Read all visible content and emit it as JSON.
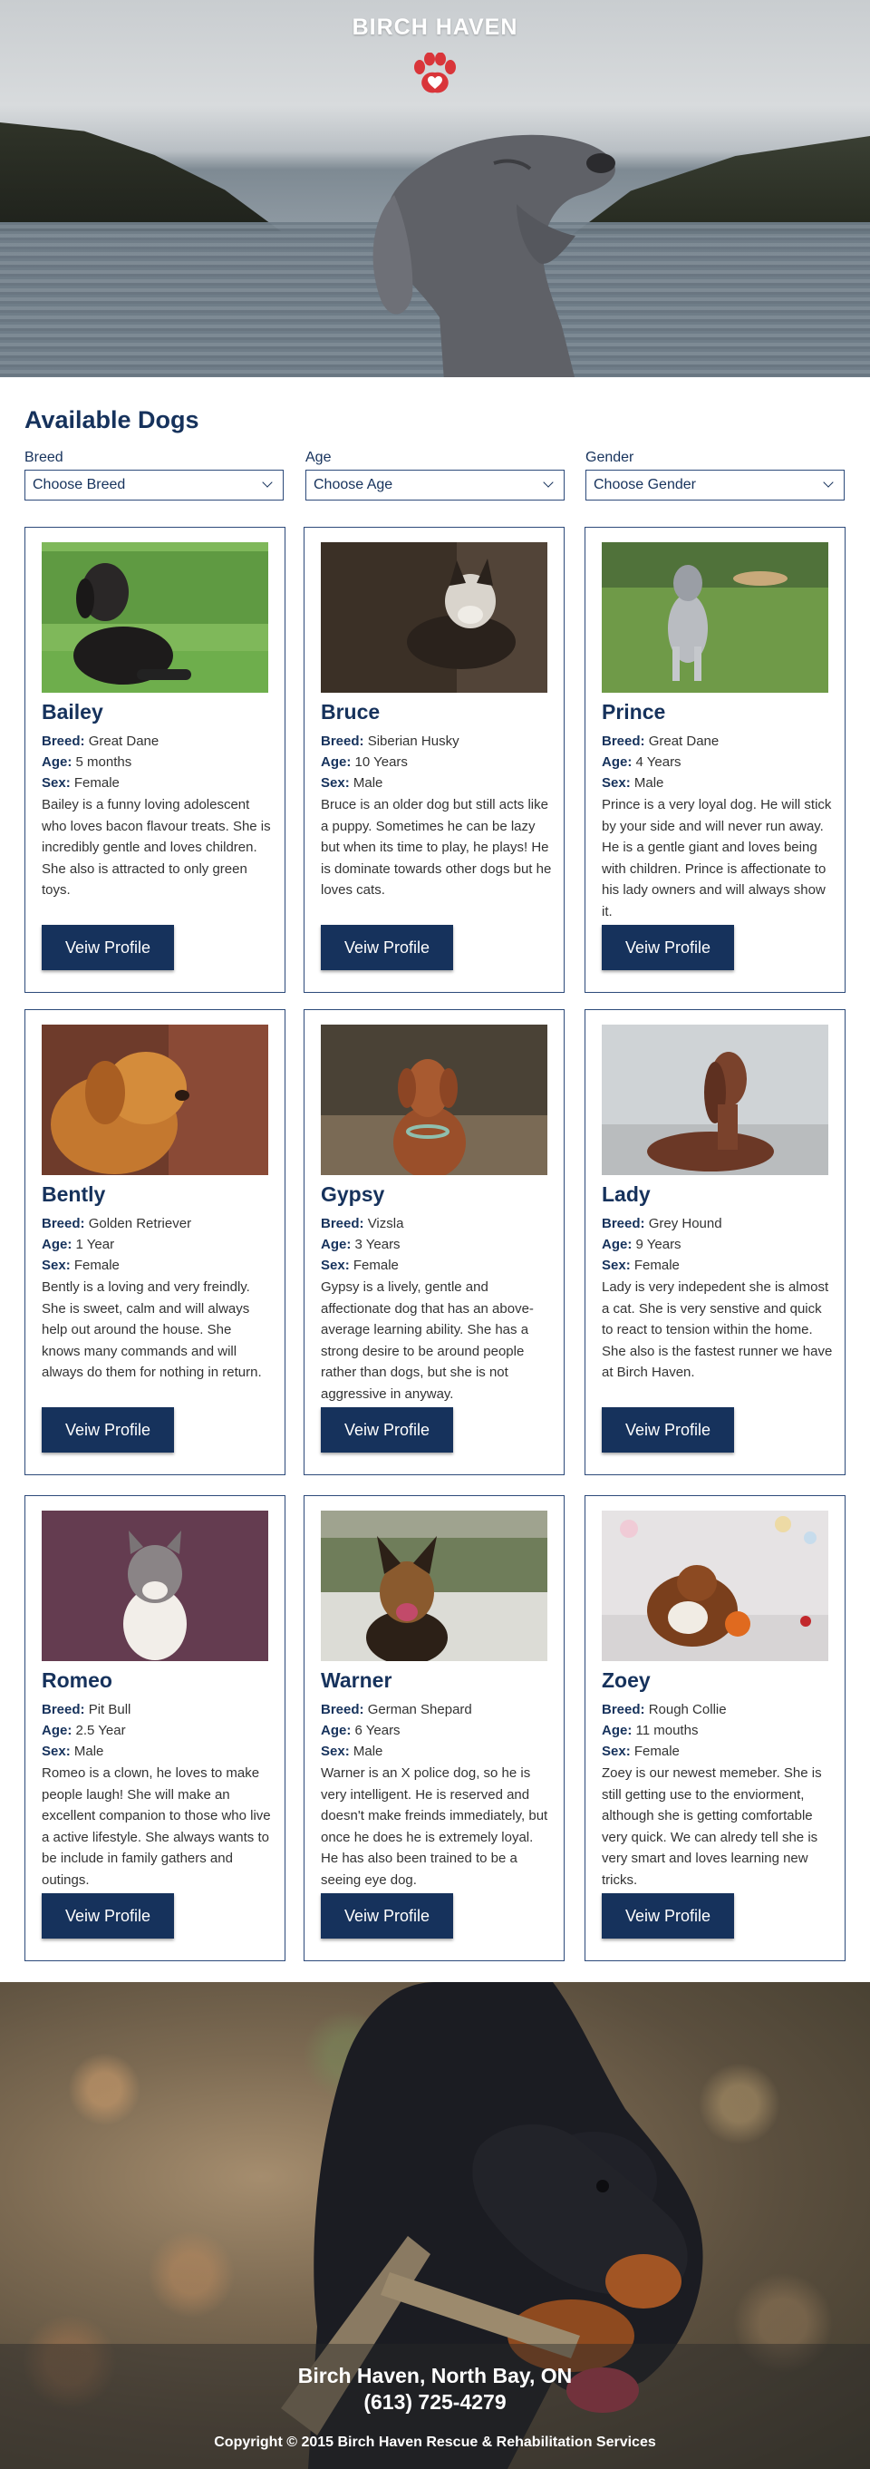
{
  "hero": {
    "title": "BIRCH HAVEN"
  },
  "section": {
    "title": "Available Dogs"
  },
  "filters": [
    {
      "label": "Breed",
      "value": "Choose Breed"
    },
    {
      "label": "Age",
      "value": "Choose Age"
    },
    {
      "label": "Gender",
      "value": "Choose Gender"
    }
  ],
  "labels": {
    "breed": "Breed:",
    "age": "Age:",
    "sex": "Sex:"
  },
  "dogs": [
    {
      "name": "Bailey",
      "breed": "Great Dane",
      "age": "5 months",
      "sex": "Female",
      "description": "Bailey is a funny loving adolescent who loves bacon flavour treats. She is incredibly gentle and loves children. She also is attracted to only green toys.",
      "button": "Veiw Profile"
    },
    {
      "name": "Bruce",
      "breed": "Siberian Husky",
      "age": "10 Years",
      "sex": "Male",
      "description": "Bruce is an older dog but still acts like a puppy. Sometimes he can be lazy but when its time to play, he plays! He is dominate towards other dogs but he loves cats.",
      "button": "Veiw Profile"
    },
    {
      "name": "Prince",
      "breed": "Great Dane",
      "age": "4 Years",
      "sex": "Male",
      "description": "Prince is a very loyal dog. He will stick by your side and will never run away. He is a gentle giant and loves being with children. Prince is affectionate to his lady owners and will always show it.",
      "button": "Veiw Profile"
    },
    {
      "name": "Bently",
      "breed": "Golden Retriever",
      "age": "1 Year",
      "sex": "Female",
      "description": "Bently is a loving and very freindly. She is sweet, calm and will always help out around the house. She knows many commands and will always do them for nothing in return.",
      "button": "Veiw Profile"
    },
    {
      "name": "Gypsy",
      "breed": "Vizsla",
      "age": "3 Years",
      "sex": "Female",
      "description": "Gypsy is a lively, gentle and affectionate dog that has an above-average learning ability. She has a strong desire to be around people rather than dogs, but she is not aggressive in anyway.",
      "button": "Veiw Profile"
    },
    {
      "name": "Lady",
      "breed": "Grey Hound",
      "age": "9 Years",
      "sex": "Female",
      "description": "Lady is very indepedent she is almost a cat. She is very senstive and quick to react to tension within the home. She also is the fastest runner we have at Birch Haven.",
      "button": "Veiw Profile"
    },
    {
      "name": "Romeo",
      "breed": "Pit Bull",
      "age": "2.5 Year",
      "sex": "Male",
      "description": "Romeo is a clown, he loves to make people laugh! She will make an excellent companion to those who live a active lifestyle. She always wants to be include in family gathers and outings.",
      "button": "Veiw Profile"
    },
    {
      "name": "Warner",
      "breed": "German Shepard",
      "age": "6 Years",
      "sex": "Male",
      "description": "Warner is an X police dog, so he is very intelligent. He is reserved and doesn't make freinds immediately, but once he does he is extremely loyal. He has also been trained to be a seeing eye dog.",
      "button": "Veiw Profile"
    },
    {
      "name": "Zoey",
      "breed": "Rough Collie",
      "age": "11 mouths",
      "sex": "Female",
      "description": "Zoey is our newest memeber. She is still getting use to the enviorment, although she is getting comfortable very quick. We can alredy tell she is very smart and loves learning new tricks.",
      "button": "Veiw Profile"
    }
  ],
  "footer": {
    "location": "Birch Haven, North Bay, ON",
    "phone": "(613) 725-4279",
    "copyright": "Copyright © 2015 Birch Haven Rescue & Rehabilitation Services"
  }
}
